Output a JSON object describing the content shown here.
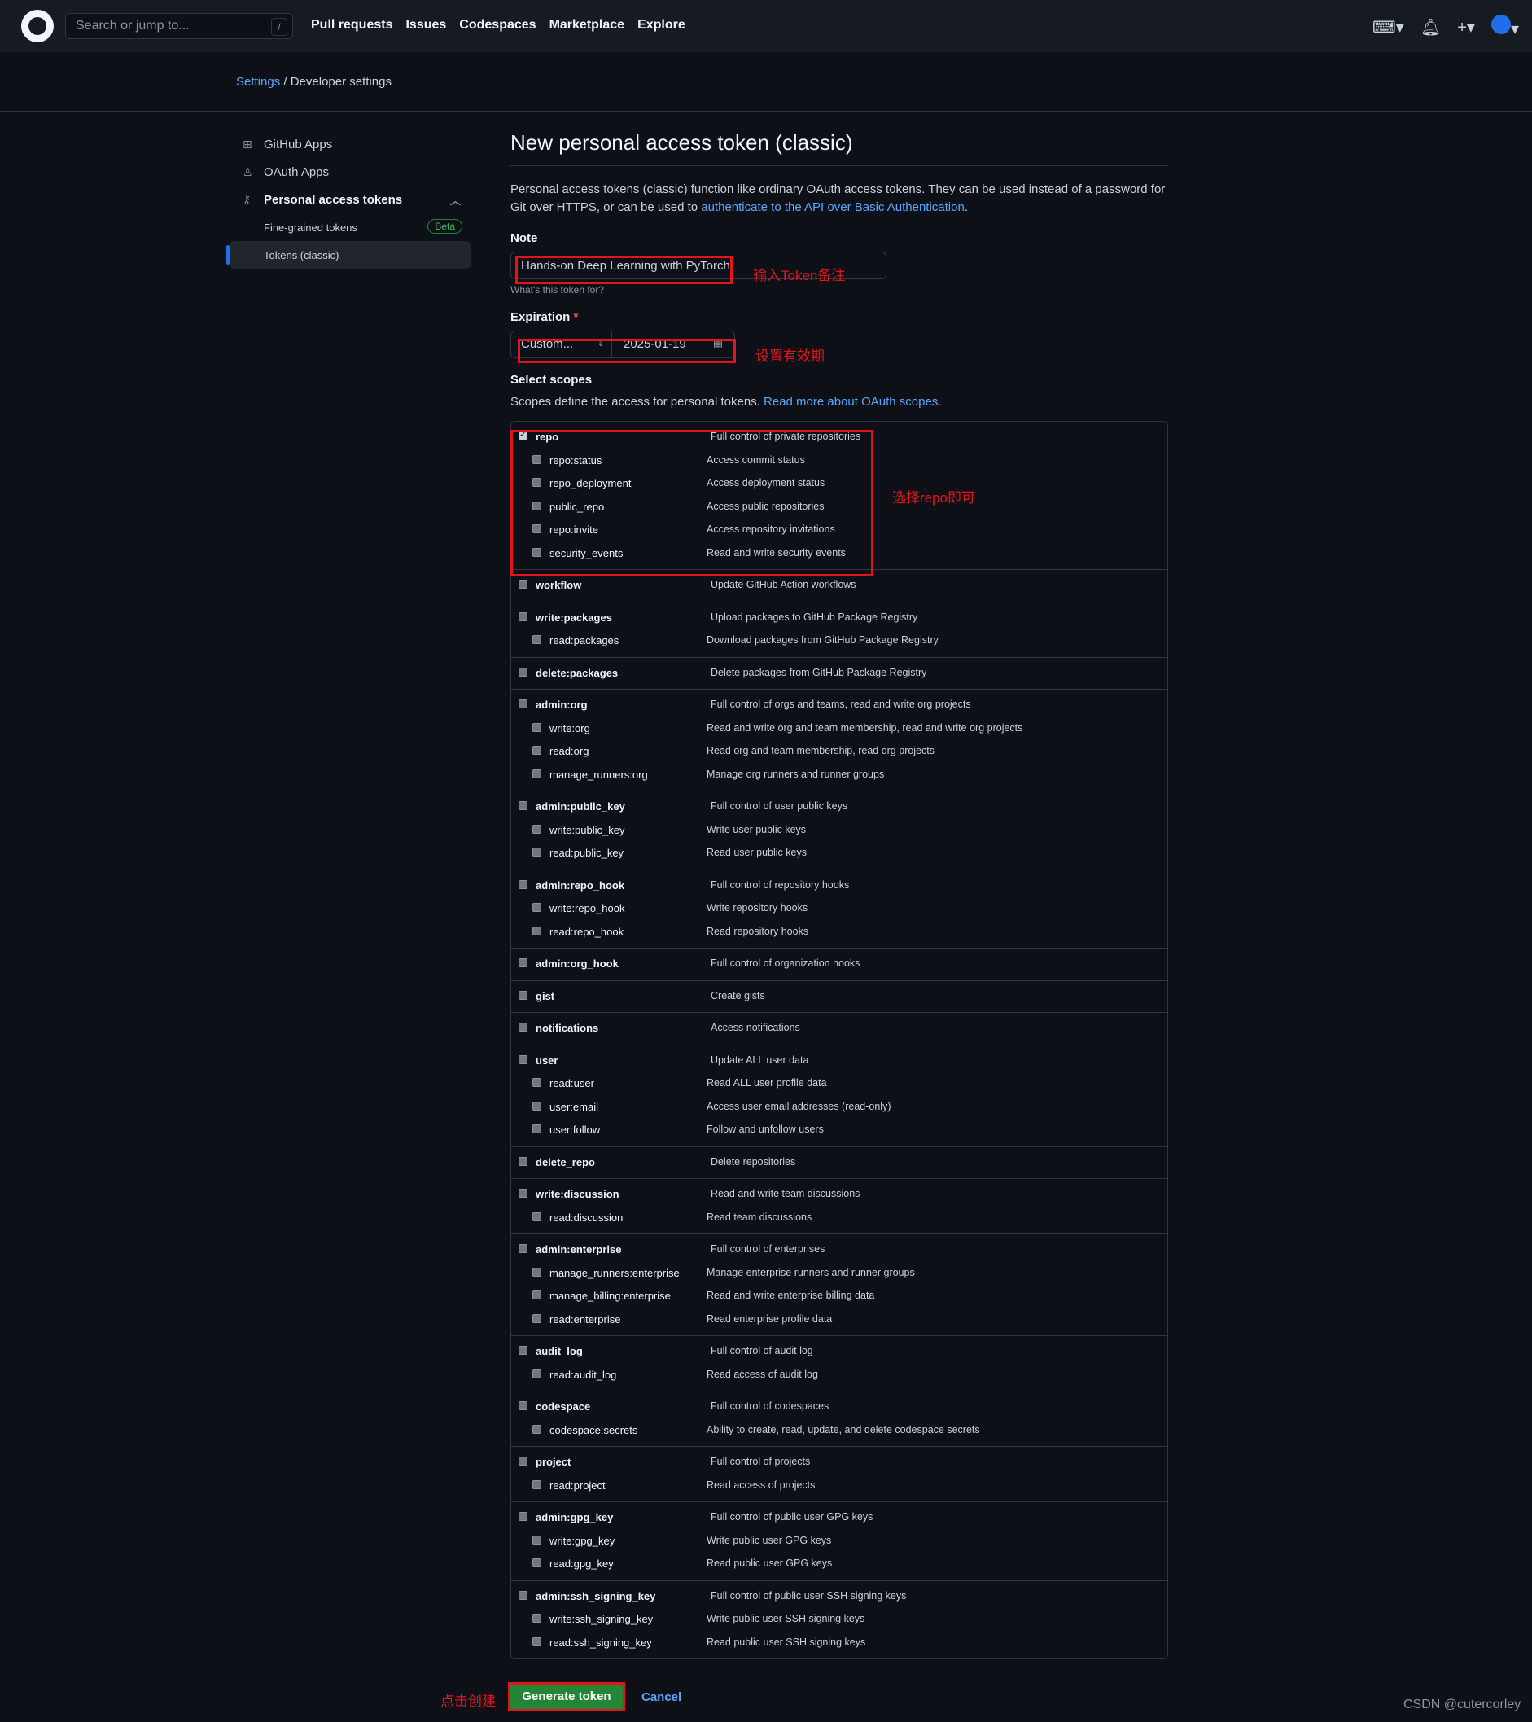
{
  "topbar": {
    "search_placeholder": "Search or jump to...",
    "slash": "/",
    "nav": [
      "Pull requests",
      "Issues",
      "Codespaces",
      "Marketplace",
      "Explore"
    ],
    "icons": [
      "terminal-icon",
      "bell-icon",
      "plus-icon",
      "avatar"
    ]
  },
  "breadcrumb": {
    "settings": "Settings",
    "sep": "/",
    "current": "Developer settings"
  },
  "sidebar": {
    "github_apps": "GitHub Apps",
    "oauth_apps": "OAuth Apps",
    "pat": "Personal access tokens",
    "fine_grained": "Fine-grained tokens",
    "beta": "Beta",
    "classic": "Tokens (classic)"
  },
  "main": {
    "title": "New personal access token (classic)",
    "intro_text": "Personal access tokens (classic) function like ordinary OAuth access tokens. They can be used instead of a password for Git over HTTPS, or can be used to ",
    "intro_link": "authenticate to the API over Basic Authentication",
    "intro_end": ".",
    "note_label": "Note",
    "note_value": "Hands-on Deep Learning with PyTorch",
    "note_hint": "What's this token for?",
    "expiration_label": "Expiration",
    "expiration_req": "*",
    "expiration_select": "Custom...",
    "expiration_date": "2025-01-19",
    "scopes_label": "Select scopes",
    "scopes_desc": "Scopes define the access for personal tokens. ",
    "scopes_link": "Read more about OAuth scopes."
  },
  "scopes": [
    {
      "name": "repo",
      "desc": "Full control of private repositories",
      "checked": true,
      "children": [
        {
          "name": "repo:status",
          "desc": "Access commit status"
        },
        {
          "name": "repo_deployment",
          "desc": "Access deployment status"
        },
        {
          "name": "public_repo",
          "desc": "Access public repositories"
        },
        {
          "name": "repo:invite",
          "desc": "Access repository invitations"
        },
        {
          "name": "security_events",
          "desc": "Read and write security events"
        }
      ]
    },
    {
      "name": "workflow",
      "desc": "Update GitHub Action workflows",
      "children": []
    },
    {
      "name": "write:packages",
      "desc": "Upload packages to GitHub Package Registry",
      "children": [
        {
          "name": "read:packages",
          "desc": "Download packages from GitHub Package Registry"
        }
      ]
    },
    {
      "name": "delete:packages",
      "desc": "Delete packages from GitHub Package Registry",
      "children": []
    },
    {
      "name": "admin:org",
      "desc": "Full control of orgs and teams, read and write org projects",
      "children": [
        {
          "name": "write:org",
          "desc": "Read and write org and team membership, read and write org projects"
        },
        {
          "name": "read:org",
          "desc": "Read org and team membership, read org projects"
        },
        {
          "name": "manage_runners:org",
          "desc": "Manage org runners and runner groups"
        }
      ]
    },
    {
      "name": "admin:public_key",
      "desc": "Full control of user public keys",
      "children": [
        {
          "name": "write:public_key",
          "desc": "Write user public keys"
        },
        {
          "name": "read:public_key",
          "desc": "Read user public keys"
        }
      ]
    },
    {
      "name": "admin:repo_hook",
      "desc": "Full control of repository hooks",
      "children": [
        {
          "name": "write:repo_hook",
          "desc": "Write repository hooks"
        },
        {
          "name": "read:repo_hook",
          "desc": "Read repository hooks"
        }
      ]
    },
    {
      "name": "admin:org_hook",
      "desc": "Full control of organization hooks",
      "children": []
    },
    {
      "name": "gist",
      "desc": "Create gists",
      "children": []
    },
    {
      "name": "notifications",
      "desc": "Access notifications",
      "children": []
    },
    {
      "name": "user",
      "desc": "Update ALL user data",
      "children": [
        {
          "name": "read:user",
          "desc": "Read ALL user profile data"
        },
        {
          "name": "user:email",
          "desc": "Access user email addresses (read-only)"
        },
        {
          "name": "user:follow",
          "desc": "Follow and unfollow users"
        }
      ]
    },
    {
      "name": "delete_repo",
      "desc": "Delete repositories",
      "children": []
    },
    {
      "name": "write:discussion",
      "desc": "Read and write team discussions",
      "children": [
        {
          "name": "read:discussion",
          "desc": "Read team discussions"
        }
      ]
    },
    {
      "name": "admin:enterprise",
      "desc": "Full control of enterprises",
      "children": [
        {
          "name": "manage_runners:enterprise",
          "desc": "Manage enterprise runners and runner groups"
        },
        {
          "name": "manage_billing:enterprise",
          "desc": "Read and write enterprise billing data"
        },
        {
          "name": "read:enterprise",
          "desc": "Read enterprise profile data"
        }
      ]
    },
    {
      "name": "audit_log",
      "desc": "Full control of audit log",
      "children": [
        {
          "name": "read:audit_log",
          "desc": "Read access of audit log"
        }
      ]
    },
    {
      "name": "codespace",
      "desc": "Full control of codespaces",
      "children": [
        {
          "name": "codespace:secrets",
          "desc": "Ability to create, read, update, and delete codespace secrets"
        }
      ]
    },
    {
      "name": "project",
      "desc": "Full control of projects",
      "children": [
        {
          "name": "read:project",
          "desc": "Read access of projects"
        }
      ]
    },
    {
      "name": "admin:gpg_key",
      "desc": "Full control of public user GPG keys",
      "children": [
        {
          "name": "write:gpg_key",
          "desc": "Write public user GPG keys"
        },
        {
          "name": "read:gpg_key",
          "desc": "Read public user GPG keys"
        }
      ]
    },
    {
      "name": "admin:ssh_signing_key",
      "desc": "Full control of public user SSH signing keys",
      "children": [
        {
          "name": "write:ssh_signing_key",
          "desc": "Write public user SSH signing keys"
        },
        {
          "name": "read:ssh_signing_key",
          "desc": "Read public user SSH signing keys"
        }
      ]
    }
  ],
  "actions": {
    "generate": "Generate token",
    "cancel": "Cancel"
  },
  "annotations": {
    "note": "输入Token备注",
    "expiration": "设置有效期",
    "repo": "选择repo即可",
    "generate": "点击创建"
  },
  "credit": "CSDN @cutercorley",
  "colors": {
    "bg": "#0d1117",
    "header": "#161b22",
    "accent": "#58a6ff",
    "green": "#238636",
    "annotation_red": "#e3141b"
  }
}
